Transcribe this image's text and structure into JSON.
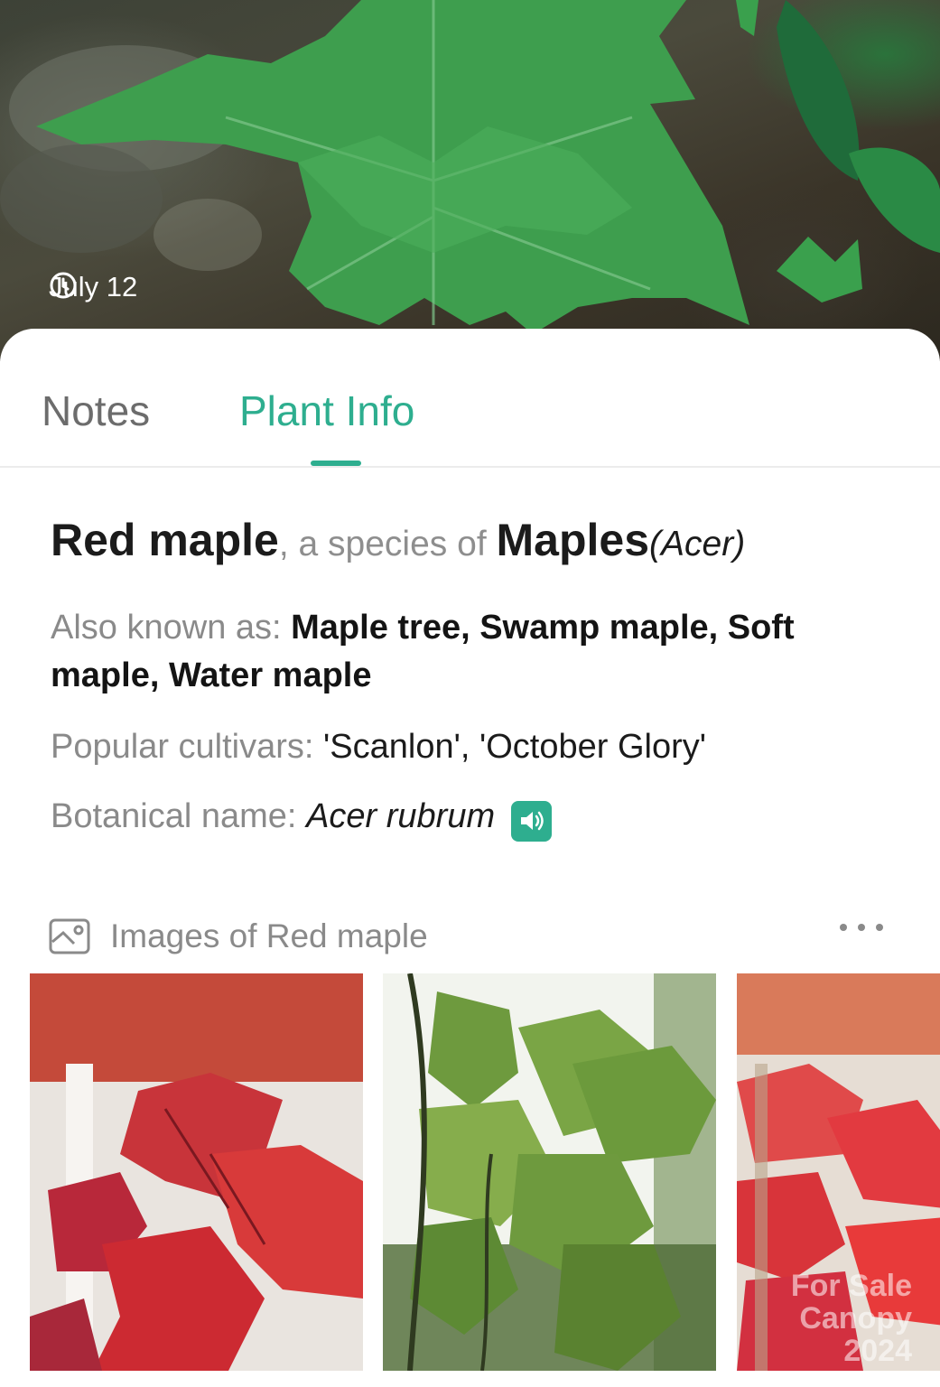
{
  "hero": {
    "date": "July 12",
    "icon": "clock-icon"
  },
  "tabs": [
    {
      "label": "Notes",
      "active": false
    },
    {
      "label": "Plant Info",
      "active": true
    }
  ],
  "accent_color": "#2eae8f",
  "plant": {
    "common_name": "Red maple",
    "species_connector": ", a species of ",
    "genus_common": "Maples",
    "genus_scientific": "(Acer)",
    "also_known_label": "Also known as: ",
    "also_known_value": "Maple tree, Swamp maple, Soft maple, Water maple",
    "cultivars_label": "Popular cultivars: ",
    "cultivars_value": "'Scanlon', 'October Glory'",
    "botanical_label": "Botanical name: ",
    "botanical_value": "Acer rubrum",
    "pronounce_icon": "speaker-icon"
  },
  "images_section": {
    "title": "Images of Red maple",
    "icon": "gallery-icon",
    "more_icon": "more-horizontal-icon",
    "thumbnails": [
      {
        "subject": "red maple leaves in autumn"
      },
      {
        "subject": "green maple leaves against sky"
      },
      {
        "subject": "red maple foliage"
      }
    ],
    "watermark_line1": "For Sale",
    "watermark_line2": "Canopy 2024"
  }
}
